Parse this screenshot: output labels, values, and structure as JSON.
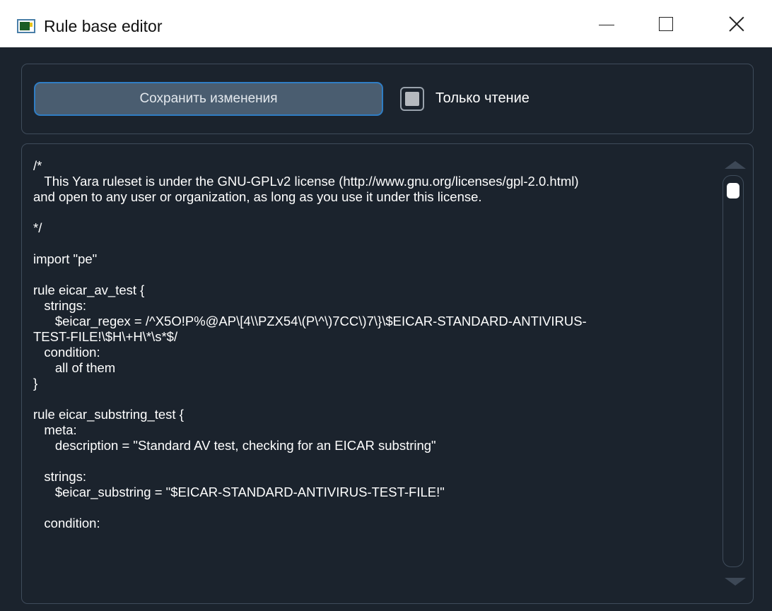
{
  "window": {
    "title": "Rule base editor"
  },
  "toolbar": {
    "save_label": "Сохранить изменения",
    "readonly_label": "Только чтение",
    "readonly_checked": true
  },
  "editor": {
    "lines": [
      "/*",
      "   This Yara ruleset is under the GNU-GPLv2 license (http://www.gnu.org/licenses/gpl-2.0.html)",
      "and open to any user or organization, as long as you use it under this license.",
      "",
      "*/",
      "",
      "import \"pe\"",
      "",
      "rule eicar_av_test {",
      "   strings:",
      "      $eicar_regex = /^X5O!P%@AP\\[4\\\\PZX54\\(P\\^\\)7CC\\)7\\}\\$EICAR-STANDARD-ANTIVIRUS-",
      "TEST-FILE!\\$H\\+H\\*\\s*$/",
      "   condition:",
      "      all of them",
      "}",
      "",
      "rule eicar_substring_test {",
      "   meta:",
      "      description = \"Standard AV test, checking for an EICAR substring\"",
      "",
      "   strings:",
      "      $eicar_substring = \"$EICAR-STANDARD-ANTIVIRUS-TEST-FILE!\"",
      "",
      "   condition:"
    ]
  }
}
